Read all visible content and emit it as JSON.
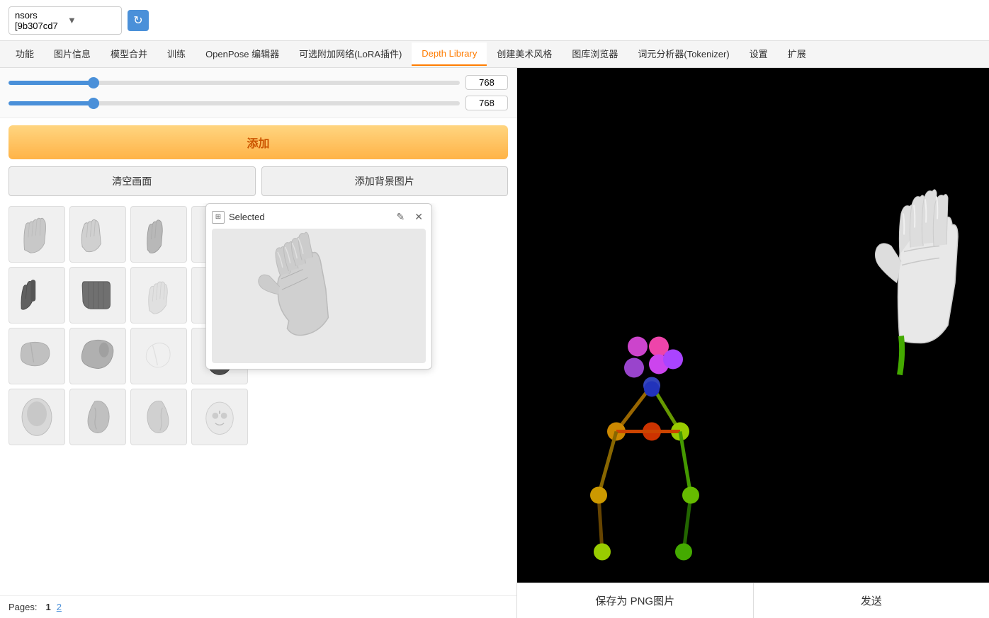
{
  "topbar": {
    "model_selector_text": "nsors [9b307cd7",
    "refresh_icon": "↻"
  },
  "tabs": [
    {
      "label": "功能",
      "id": "features",
      "active": false
    },
    {
      "label": "图片信息",
      "id": "image-info",
      "active": false
    },
    {
      "label": "模型合并",
      "id": "model-merge",
      "active": false
    },
    {
      "label": "训练",
      "id": "train",
      "active": false
    },
    {
      "label": "OpenPose 编辑器",
      "id": "openpose",
      "active": false
    },
    {
      "label": "可选附加网络(LoRA插件)",
      "id": "lora",
      "active": false
    },
    {
      "label": "Depth Library",
      "id": "depth-library",
      "active": true
    },
    {
      "label": "创建美术风格",
      "id": "art-style",
      "active": false
    },
    {
      "label": "图库浏览器",
      "id": "gallery",
      "active": false
    },
    {
      "label": "词元分析器(Tokenizer)",
      "id": "tokenizer",
      "active": false
    },
    {
      "label": "设置",
      "id": "settings",
      "active": false
    },
    {
      "label": "扩展",
      "id": "extensions",
      "active": false
    }
  ],
  "sliders": [
    {
      "value": "768",
      "position": 18
    },
    {
      "value": "768",
      "position": 18
    }
  ],
  "add_button_label": "添加",
  "clear_button_label": "清空画面",
  "add_bg_button_label": "添加背景图片",
  "selected_popup": {
    "icon": "⊞",
    "title": "Selected",
    "edit_icon": "✎",
    "close_icon": "✕"
  },
  "pagination": {
    "label": "Pages:",
    "pages": [
      "1",
      "2"
    ],
    "current": "1"
  },
  "bottom_buttons": {
    "save_label": "保存为 PNG图片",
    "send_label": "发送"
  },
  "grid_items": [
    {
      "row": 0,
      "col": 0,
      "type": "hand-right-open"
    },
    {
      "row": 0,
      "col": 1,
      "type": "hand-left-point"
    },
    {
      "row": 0,
      "col": 2,
      "type": "hand-two-finger"
    },
    {
      "row": 0,
      "col": 3,
      "type": "hand-dark-spread"
    },
    {
      "row": 1,
      "col": 0,
      "type": "hand-dark-point"
    },
    {
      "row": 1,
      "col": 1,
      "type": "hand-dark-back"
    },
    {
      "row": 1,
      "col": 2,
      "type": "hand-light-open"
    },
    {
      "row": 1,
      "col": 3,
      "type": "hand-dark-v"
    },
    {
      "row": 2,
      "col": 0,
      "type": "foot-right"
    },
    {
      "row": 2,
      "col": 1,
      "type": "foot-heel"
    },
    {
      "row": 2,
      "col": 2,
      "type": "foot-light"
    },
    {
      "row": 2,
      "col": 3,
      "type": "head-dark"
    },
    {
      "row": 3,
      "col": 0,
      "type": "head-light"
    },
    {
      "row": 3,
      "col": 1,
      "type": "ear-right"
    },
    {
      "row": 3,
      "col": 2,
      "type": "ear-left"
    },
    {
      "row": 3,
      "col": 3,
      "type": "face-front"
    }
  ]
}
